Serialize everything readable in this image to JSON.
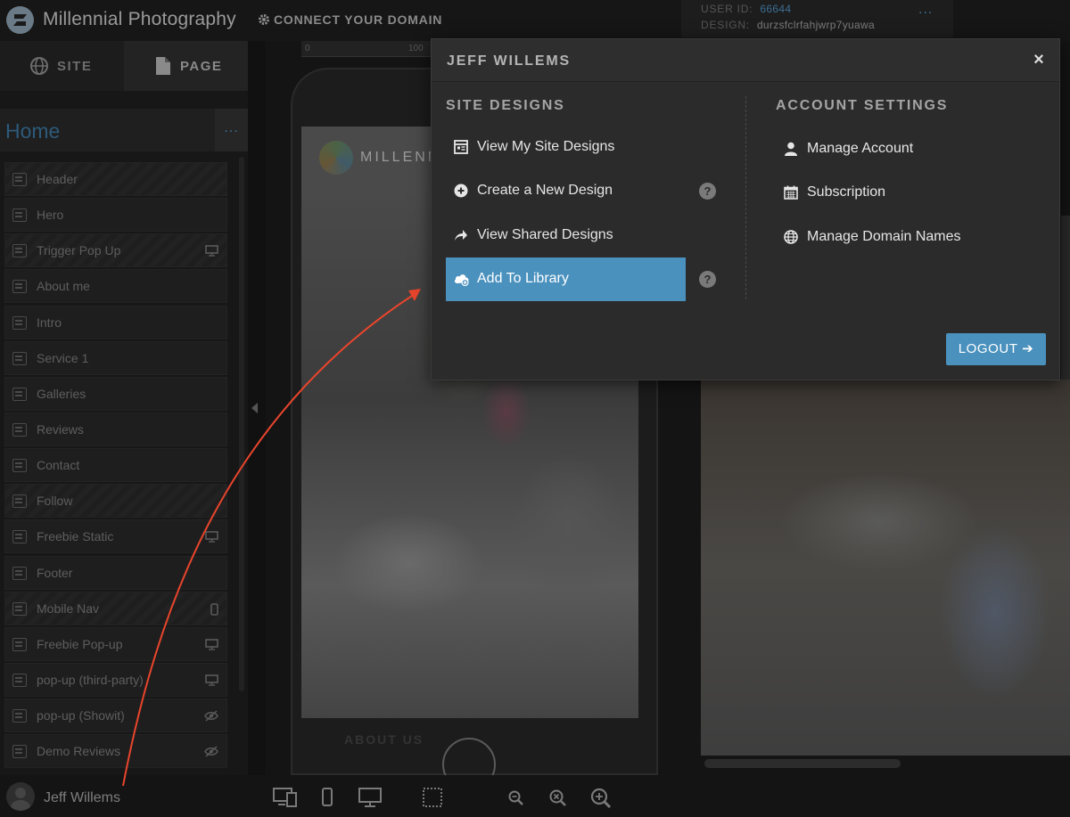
{
  "app": {
    "title": "Millennial Photography",
    "connect_domain_label": "CONNECT YOUR DOMAIN"
  },
  "user_info": {
    "user_id_label": "USER ID:",
    "user_id": "66644",
    "design_label": "DESIGN:",
    "design": "durzsfclrfahjwrp7yuawa",
    "more": "..."
  },
  "sidebar": {
    "tabs": [
      {
        "label": "SITE",
        "icon": "globe-icon"
      },
      {
        "label": "PAGE",
        "icon": "page-icon"
      }
    ],
    "page_name": "Home",
    "page_more": "...",
    "sections": [
      {
        "label": "Header",
        "striped": true,
        "device": ""
      },
      {
        "label": "Hero",
        "striped": false,
        "device": ""
      },
      {
        "label": "Trigger Pop Up",
        "striped": true,
        "device": "desktop"
      },
      {
        "label": "About me",
        "striped": false,
        "device": ""
      },
      {
        "label": "Intro",
        "striped": false,
        "device": ""
      },
      {
        "label": "Service 1",
        "striped": false,
        "device": ""
      },
      {
        "label": "Galleries",
        "striped": false,
        "device": ""
      },
      {
        "label": "Reviews",
        "striped": false,
        "device": ""
      },
      {
        "label": "Contact",
        "striped": false,
        "device": ""
      },
      {
        "label": "Follow",
        "striped": true,
        "device": ""
      },
      {
        "label": "Freebie Static",
        "striped": false,
        "device": "desktop"
      },
      {
        "label": "Footer",
        "striped": false,
        "device": ""
      },
      {
        "label": "Mobile Nav",
        "striped": true,
        "device": "mobile"
      },
      {
        "label": "Freebie Pop-up",
        "striped": false,
        "device": "desktop"
      },
      {
        "label": "pop-up (third-party)",
        "striped": false,
        "device": "desktop"
      },
      {
        "label": "pop-up (Showit)",
        "striped": false,
        "device": "hidden"
      },
      {
        "label": "Demo Reviews",
        "striped": false,
        "device": "hidden"
      }
    ]
  },
  "bottom_bar": {
    "user_name": "Jeff Willems"
  },
  "canvas": {
    "ruler_ticks": [
      "0",
      "100"
    ],
    "site_title": "MILLENNIA",
    "nav_about": "ABOUT US"
  },
  "modal": {
    "title": "JEFF WILLEMS",
    "close": "×",
    "site_designs": {
      "heading": "SITE DESIGNS",
      "items": [
        {
          "label": "View My Site Designs",
          "icon": "layout-icon",
          "help": false,
          "active": false
        },
        {
          "label": "Create a New Design",
          "icon": "plus-circle-icon",
          "help": true,
          "active": false
        },
        {
          "label": "View Shared Designs",
          "icon": "share-arrow-icon",
          "help": false,
          "active": false
        },
        {
          "label": "Add To Library",
          "icon": "cloud-upload-icon",
          "help": true,
          "active": true
        }
      ]
    },
    "account_settings": {
      "heading": "ACCOUNT SETTINGS",
      "items": [
        {
          "label": "Manage Account",
          "icon": "user-icon"
        },
        {
          "label": "Subscription",
          "icon": "calendar-icon"
        },
        {
          "label": "Manage Domain Names",
          "icon": "globe-icon"
        }
      ]
    },
    "help_glyph": "?",
    "logout_label": "LOGOUT ➔"
  },
  "colors": {
    "accent": "#4a91be",
    "annotation_arrow": "#e8452c"
  }
}
